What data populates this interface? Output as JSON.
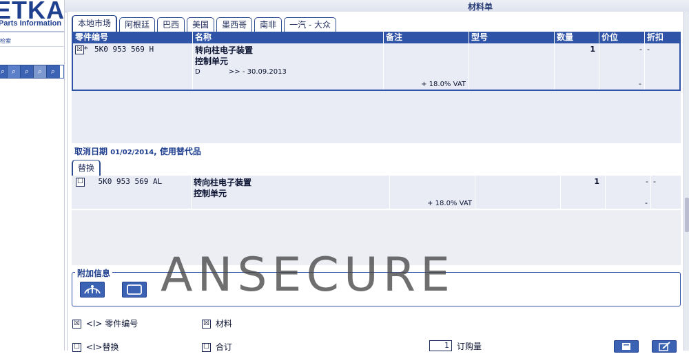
{
  "brand": {
    "logo": "ETKA",
    "subtitle": "Parts Information",
    "search_label": "检索"
  },
  "window": {
    "title": "材料单"
  },
  "tabs": [
    "本地市场",
    "阿根廷",
    "巴西",
    "美国",
    "墨西哥",
    "南非",
    "一汽 - 大众"
  ],
  "table": {
    "headers": [
      "零件编号",
      "名称",
      "备注",
      "型号",
      "数量",
      "价位",
      "折扣"
    ],
    "row": {
      "checkbox": "☒",
      "star": "*",
      "part_number": "5K0 953 569 H",
      "name_line1": "转向柱电子装置",
      "name_line2": "控制单元",
      "code": "D",
      "date_range": ">> - 30.09.2013",
      "vat": "+ 18.0% VAT",
      "qty": "1",
      "price": "-",
      "discount": "-",
      "price_dash2": "-"
    }
  },
  "cancel_notice": {
    "prefix": "取消日期 ",
    "date": "01/02/2014",
    "suffix": ", 使用替代品"
  },
  "replacement": {
    "tab": "替换",
    "row": {
      "checkbox": "☐",
      "part_number": "5K0 953 569 AL",
      "name_line1": "转向柱电子装置",
      "name_line2": "控制单元",
      "vat": "+ 18.0% VAT",
      "qty": "1",
      "price": "-",
      "discount": "-",
      "price_dash2": "-"
    }
  },
  "additional_info": {
    "legend": "附加信息"
  },
  "watermark": "ANSECURE",
  "options": {
    "part_number": {
      "checked": "☒",
      "label": "<I> 零件编号"
    },
    "material": {
      "checked": "☒",
      "label": "材料"
    },
    "replace": {
      "checked": "☐",
      "label": "<I>替换"
    },
    "contract": {
      "checked": "☐",
      "label": "合订"
    },
    "order_qty": {
      "value": "1",
      "label": "订购量"
    }
  }
}
